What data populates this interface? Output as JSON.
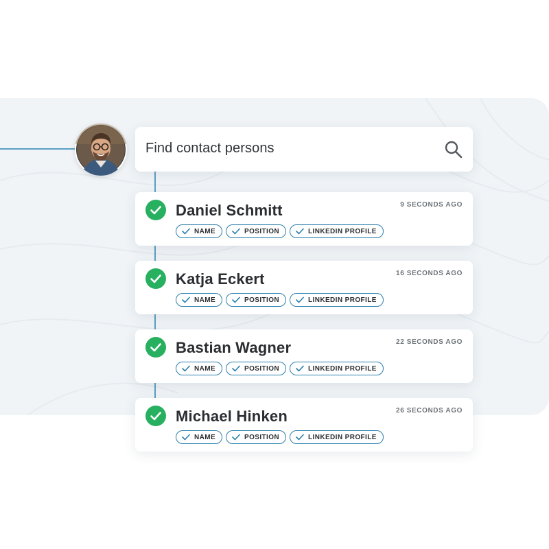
{
  "search": {
    "placeholder": "Find contact persons"
  },
  "contacts": [
    {
      "name": "Daniel Schmitt",
      "time": "9 SECONDS AGO",
      "tags": [
        "NAME",
        "POSITION",
        "LINKEDIN PROFILE"
      ]
    },
    {
      "name": "Katja Eckert",
      "time": "16 SECONDS AGO",
      "tags": [
        "NAME",
        "POSITION",
        "LINKEDIN PROFILE"
      ]
    },
    {
      "name": "Bastian Wagner",
      "time": "22 SECONDS AGO",
      "tags": [
        "NAME",
        "POSITION",
        "LINKEDIN PROFILE"
      ]
    },
    {
      "name": "Michael Hinken",
      "time": "26 SECONDS AGO",
      "tags": [
        "NAME",
        "POSITION",
        "LINKEDIN PROFILE"
      ]
    }
  ],
  "icons": {
    "search": "search-icon",
    "check": "check-circle-icon",
    "tag_check": "checkmark-icon",
    "avatar": "user-avatar-photo"
  },
  "colors": {
    "accent": "#2a7fae",
    "connector": "#5b9fc2",
    "success": "#27b05f",
    "backdrop": "#f0f4f7"
  }
}
